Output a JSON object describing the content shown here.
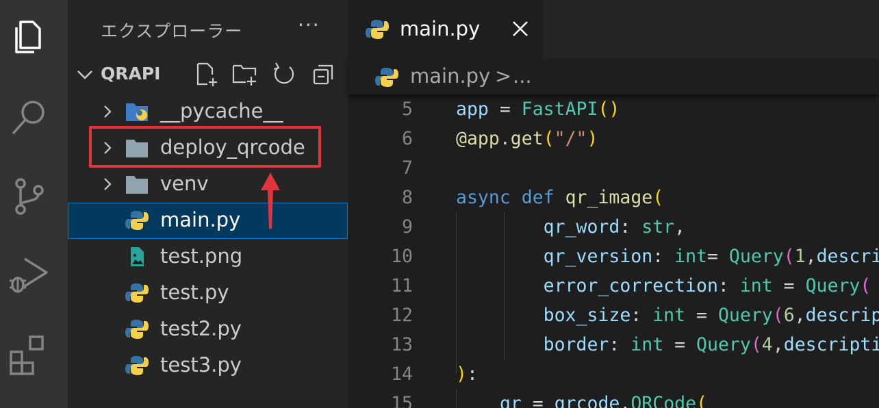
{
  "colors": {
    "keyword": "#569cd6",
    "class": "#4ec9b0",
    "function": "#dcdcaa",
    "variable": "#9cdcfe",
    "string": "#ce9178",
    "number": "#b5cea8",
    "bracket1": "#ffd700",
    "bracket2": "#da70d6",
    "text": "#d4d4d4",
    "highlight": "#e0343f"
  },
  "sidebar": {
    "title": "エクスプローラー",
    "more": "···",
    "project": "QRAPI",
    "toolbar": [
      "new-file-icon",
      "new-folder-icon",
      "refresh-icon",
      "collapse-all-icon"
    ],
    "items": [
      {
        "label": "__pycache__",
        "type": "folder-python",
        "expandable": true
      },
      {
        "label": "deploy_qrcode",
        "type": "folder",
        "expandable": true
      },
      {
        "label": "venv",
        "type": "folder",
        "expandable": true
      },
      {
        "label": "main.py",
        "type": "python",
        "expandable": false,
        "selected": true
      },
      {
        "label": "test.png",
        "type": "image",
        "expandable": false
      },
      {
        "label": "test.py",
        "type": "python",
        "expandable": false
      },
      {
        "label": "test2.py",
        "type": "python",
        "expandable": false
      },
      {
        "label": "test3.py",
        "type": "python",
        "expandable": false
      }
    ]
  },
  "editor": {
    "tab": {
      "label": "main.py"
    },
    "breadcrumb": {
      "file": "main.py",
      "separator": ">",
      "more": "..."
    },
    "lines": [
      {
        "n": "5",
        "tokens": [
          [
            "app",
            "variable"
          ],
          [
            " = ",
            "text"
          ],
          [
            "FastAPI",
            "class"
          ],
          [
            "()",
            "bracket1"
          ]
        ]
      },
      {
        "n": "6",
        "tokens": [
          [
            "@app",
            "function"
          ],
          [
            ".",
            "text"
          ],
          [
            "get",
            "function"
          ],
          [
            "(",
            "bracket1"
          ],
          [
            "\"/\"",
            "string"
          ],
          [
            ")",
            "bracket1"
          ]
        ]
      },
      {
        "n": "7",
        "tokens": []
      },
      {
        "n": "8",
        "tokens": [
          [
            "async",
            "keyword"
          ],
          [
            " ",
            "text"
          ],
          [
            "def",
            "keyword"
          ],
          [
            " ",
            "text"
          ],
          [
            "qr_image",
            "function"
          ],
          [
            "(",
            "bracket1"
          ]
        ]
      },
      {
        "n": "9",
        "tokens": [
          [
            "        ",
            "text"
          ],
          [
            "qr_word",
            "variable"
          ],
          [
            ": ",
            "text"
          ],
          [
            "str",
            "class"
          ],
          [
            ",",
            "text"
          ]
        ]
      },
      {
        "n": "10",
        "tokens": [
          [
            "        ",
            "text"
          ],
          [
            "qr_version",
            "variable"
          ],
          [
            ": ",
            "text"
          ],
          [
            "int",
            "class"
          ],
          [
            "= ",
            "text"
          ],
          [
            "Query",
            "class"
          ],
          [
            "(",
            "bracket2"
          ],
          [
            "1",
            "number"
          ],
          [
            ",",
            "text"
          ],
          [
            "description",
            "variable"
          ]
        ]
      },
      {
        "n": "11",
        "tokens": [
          [
            "        ",
            "text"
          ],
          [
            "error_correction",
            "variable"
          ],
          [
            ": ",
            "text"
          ],
          [
            "int",
            "class"
          ],
          [
            " = ",
            "text"
          ],
          [
            "Query",
            "class"
          ],
          [
            "(",
            "bracket2"
          ]
        ]
      },
      {
        "n": "12",
        "tokens": [
          [
            "        ",
            "text"
          ],
          [
            "box_size",
            "variable"
          ],
          [
            ": ",
            "text"
          ],
          [
            "int",
            "class"
          ],
          [
            " = ",
            "text"
          ],
          [
            "Query",
            "class"
          ],
          [
            "(",
            "bracket2"
          ],
          [
            "6",
            "number"
          ],
          [
            ",",
            "text"
          ],
          [
            "description",
            "variable"
          ]
        ]
      },
      {
        "n": "13",
        "tokens": [
          [
            "        ",
            "text"
          ],
          [
            "border",
            "variable"
          ],
          [
            ": ",
            "text"
          ],
          [
            "int",
            "class"
          ],
          [
            " = ",
            "text"
          ],
          [
            "Query",
            "class"
          ],
          [
            "(",
            "bracket2"
          ],
          [
            "4",
            "number"
          ],
          [
            ",",
            "text"
          ],
          [
            "description",
            "variable"
          ]
        ]
      },
      {
        "n": "14",
        "tokens": [
          [
            ")",
            "bracket1"
          ],
          [
            ":",
            "text"
          ]
        ]
      },
      {
        "n": "15",
        "tokens": [
          [
            "    ",
            "text"
          ],
          [
            "qr",
            "variable"
          ],
          [
            " = ",
            "text"
          ],
          [
            "qrcode",
            "variable"
          ],
          [
            ".",
            "text"
          ],
          [
            "QRCode",
            "class"
          ],
          [
            "(",
            "bracket1"
          ]
        ]
      }
    ]
  }
}
